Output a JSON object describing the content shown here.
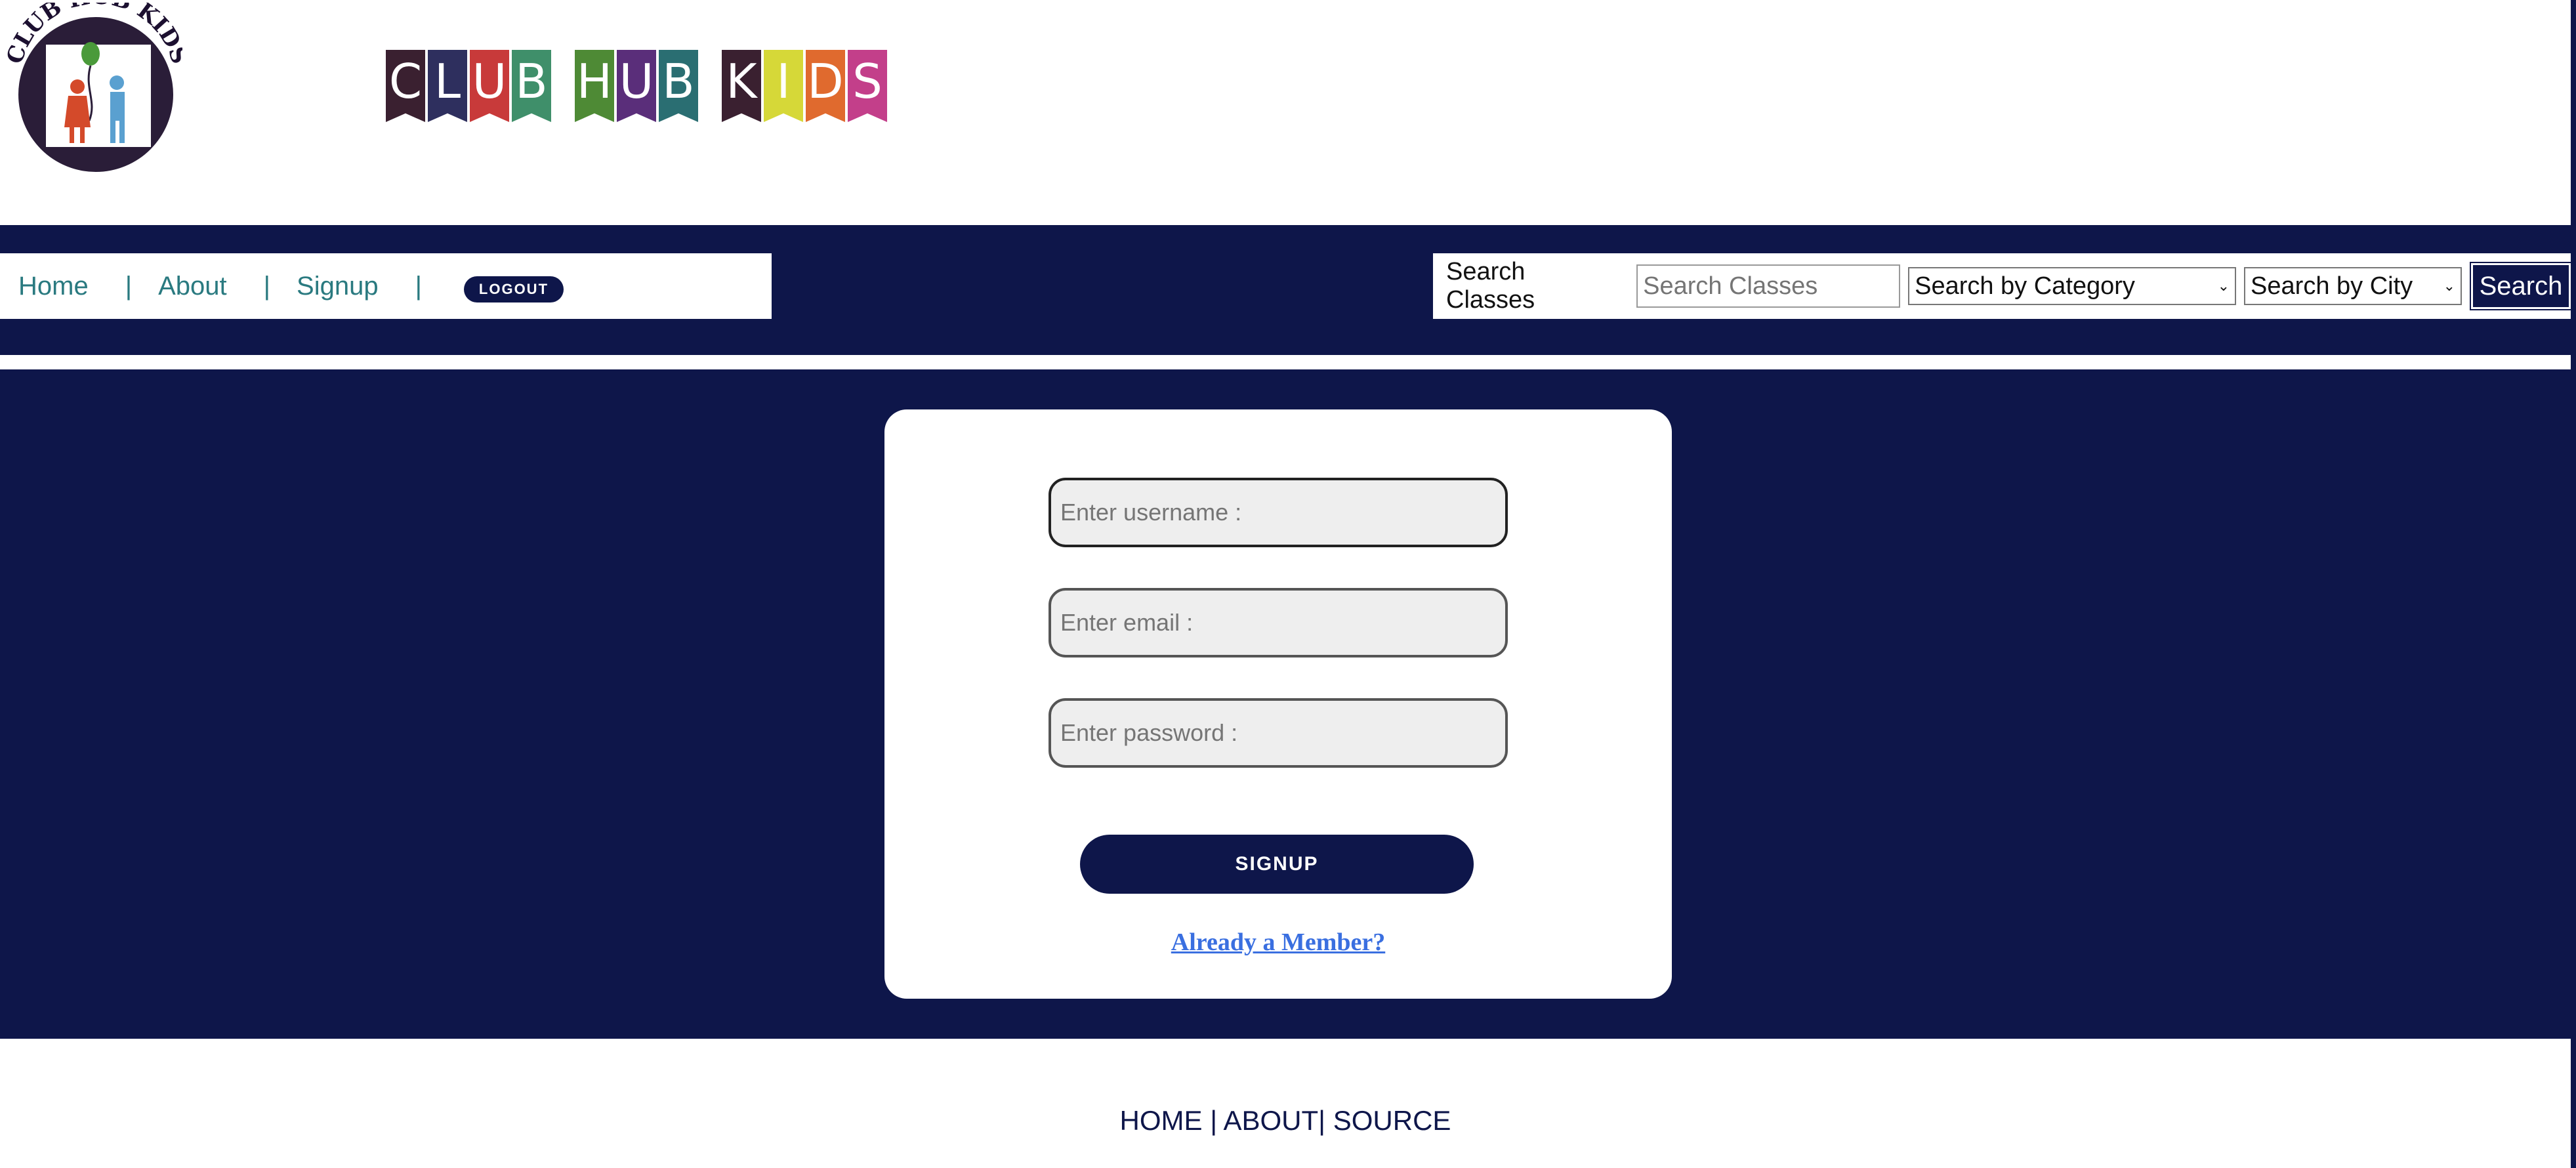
{
  "header": {
    "logo_text": "CLUB HUB KIDS",
    "banner_letters": [
      {
        "ch": "C",
        "color": "#3a2030"
      },
      {
        "ch": "L",
        "color": "#2e2f5e"
      },
      {
        "ch": "U",
        "color": "#c83a3a"
      },
      {
        "ch": "B",
        "color": "#3f8f6a"
      },
      {
        "ch": "H",
        "color": "#4e8a35"
      },
      {
        "ch": "U",
        "color": "#5a2e7a"
      },
      {
        "ch": "B",
        "color": "#2a6e72"
      },
      {
        "ch": "K",
        "color": "#3a2030"
      },
      {
        "ch": "I",
        "color": "#d6d838"
      },
      {
        "ch": "D",
        "color": "#e06a2e"
      },
      {
        "ch": "S",
        "color": "#c33f8a"
      }
    ]
  },
  "nav": {
    "home": "Home",
    "about": "About",
    "signup": "Signup",
    "sep": "|",
    "logout": "LOGOUT"
  },
  "search": {
    "label": "Search Classes",
    "placeholder": "Search Classes",
    "category": "Search by Category",
    "city": "Search by City",
    "button": "Search"
  },
  "form": {
    "username_placeholder": "Enter username :",
    "email_placeholder": "Enter email :",
    "password_placeholder": "Enter password :",
    "submit": "SIGNUP",
    "member_link": "Already a Member?"
  },
  "footer": {
    "home": "HOME",
    "about": "ABOUT",
    "source": "SOURCE"
  },
  "colors": {
    "navy": "#0e164a",
    "link_teal": "#2a7a80",
    "link_blue": "#3a6fe0"
  }
}
